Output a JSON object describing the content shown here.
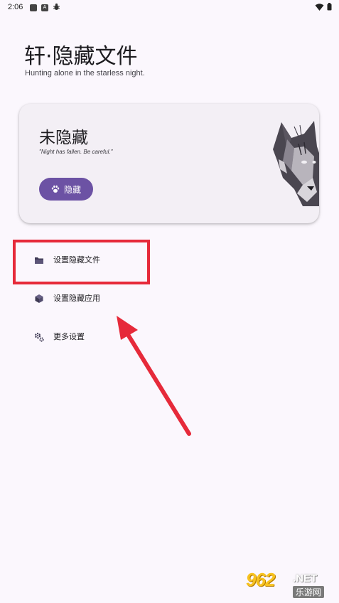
{
  "status_bar": {
    "time": "2:06",
    "icons": [
      "notification-square-icon",
      "a-badge-icon",
      "bug-icon",
      "wifi-icon",
      "battery-icon"
    ],
    "a_badge": "A"
  },
  "header": {
    "title": "轩·隐藏文件",
    "subtitle": "Hunting alone in the starless night."
  },
  "status_card": {
    "title": "未隐藏",
    "quote": "\"Night has fallen. Be careful.\"",
    "button_label": "隐藏",
    "button_icon": "paw-icon"
  },
  "menu": {
    "items": [
      {
        "label": "设置隐藏文件",
        "icon": "folder-icon"
      },
      {
        "label": "设置隐藏应用",
        "icon": "cube-icon"
      },
      {
        "label": "更多设置",
        "icon": "gears-icon"
      }
    ]
  },
  "watermark": {
    "number": "962",
    "suffix": ".NET",
    "cn": "乐游网"
  },
  "colors": {
    "background": "#fbf7fd",
    "card": "#f3eff5",
    "accent": "#6c52a4",
    "highlight": "#e62a3a"
  }
}
